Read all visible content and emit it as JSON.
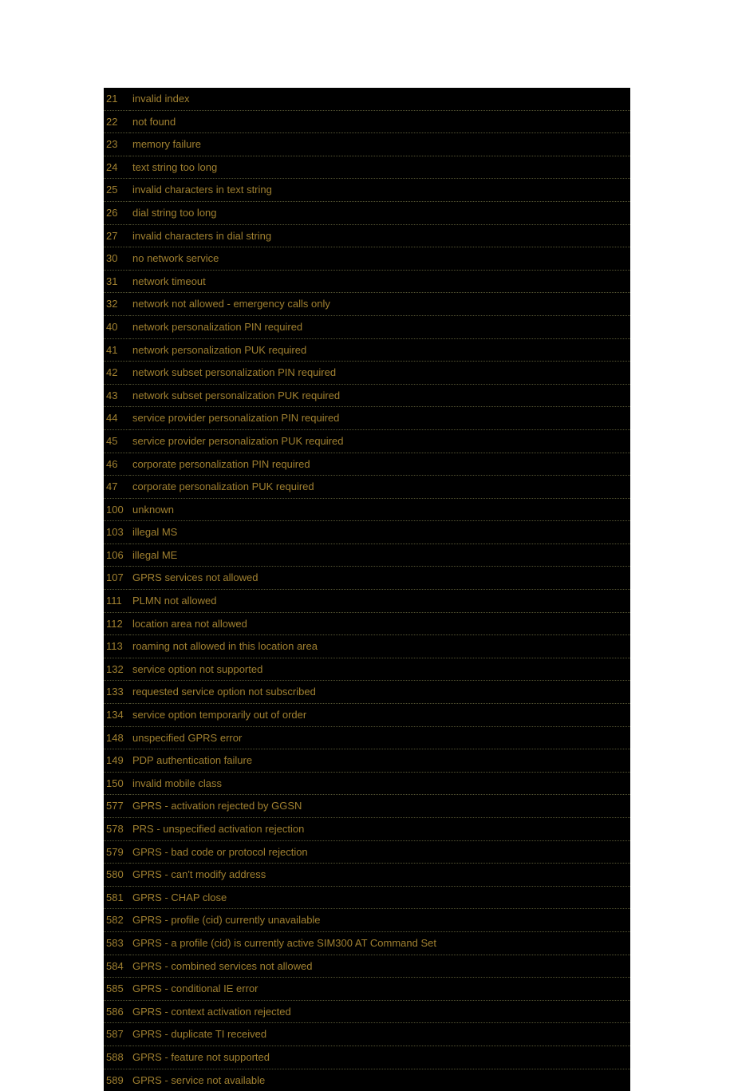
{
  "rows": [
    {
      "code": "21",
      "desc": "invalid index"
    },
    {
      "code": "22",
      "desc": "not found"
    },
    {
      "code": "23",
      "desc": "memory failure"
    },
    {
      "code": "24",
      "desc": " text string too long"
    },
    {
      "code": "25",
      "desc": " invalid characters in text string"
    },
    {
      "code": "26",
      "desc": " dial string too long"
    },
    {
      "code": "27",
      "desc": " invalid characters in dial string"
    },
    {
      "code": "30",
      "desc": "no network service"
    },
    {
      "code": "31",
      "desc": "network timeout"
    },
    {
      "code": "32",
      "desc": " network not allowed - emergency calls only"
    },
    {
      "code": "40",
      "desc": " network personalization PIN required"
    },
    {
      "code": "41",
      "desc": " network personalization PUK required"
    },
    {
      "code": "42",
      "desc": " network subset personalization PIN required"
    },
    {
      "code": "43",
      "desc": " network subset personalization PUK required"
    },
    {
      "code": "44",
      "desc": " service provider personalization PIN required"
    },
    {
      "code": "45",
      "desc": " service provider personalization PUK required"
    },
    {
      "code": "46",
      "desc": " corporate personalization PIN required"
    },
    {
      "code": "47",
      "desc": " corporate personalization PUK required"
    },
    {
      "code": "100",
      "desc": "unknown"
    },
    {
      "code": "103",
      "desc": "illegal MS"
    },
    {
      "code": "106",
      "desc": "illegal ME"
    },
    {
      "code": "107",
      "desc": " GPRS services not allowed"
    },
    {
      "code": "111",
      "desc": " PLMN not allowed"
    },
    {
      "code": "112",
      "desc": " location area not allowed"
    },
    {
      "code": "113",
      "desc": " roaming not allowed in this location area"
    },
    {
      "code": "132",
      "desc": " service option not supported"
    },
    {
      "code": "133",
      "desc": " requested service option not subscribed"
    },
    {
      "code": "134",
      "desc": " service option temporarily out of order"
    },
    {
      "code": "148",
      "desc": " unspecified GPRS error"
    },
    {
      "code": "149",
      "desc": " PDP authentication failure"
    },
    {
      "code": "150",
      "desc": " invalid mobile class"
    },
    {
      "code": "577",
      "desc": " GPRS - activation rejected by GGSN"
    },
    {
      "code": "578",
      "desc": " PRS - unspecified activation rejection"
    },
    {
      "code": "579",
      "desc": " GPRS - bad code or protocol rejection"
    },
    {
      "code": "580",
      "desc": " GPRS - can't modify address"
    },
    {
      "code": "581",
      "desc": " GPRS - CHAP close"
    },
    {
      "code": "582",
      "desc": " GPRS - profile (cid) currently unavailable"
    },
    {
      "code": "583",
      "desc": " GPRS - a profile (cid) is currently active SIM300 AT Command Set"
    },
    {
      "code": "584",
      "desc": " GPRS - combined services not allowed"
    },
    {
      "code": "585",
      "desc": " GPRS - conditional IE error"
    },
    {
      "code": "586",
      "desc": " GPRS - context activation rejected"
    },
    {
      "code": "587",
      "desc": " GPRS - duplicate TI received"
    },
    {
      "code": "588",
      "desc": " GPRS - feature not supported"
    },
    {
      "code": "589",
      "desc": " GPRS - service not available"
    }
  ]
}
